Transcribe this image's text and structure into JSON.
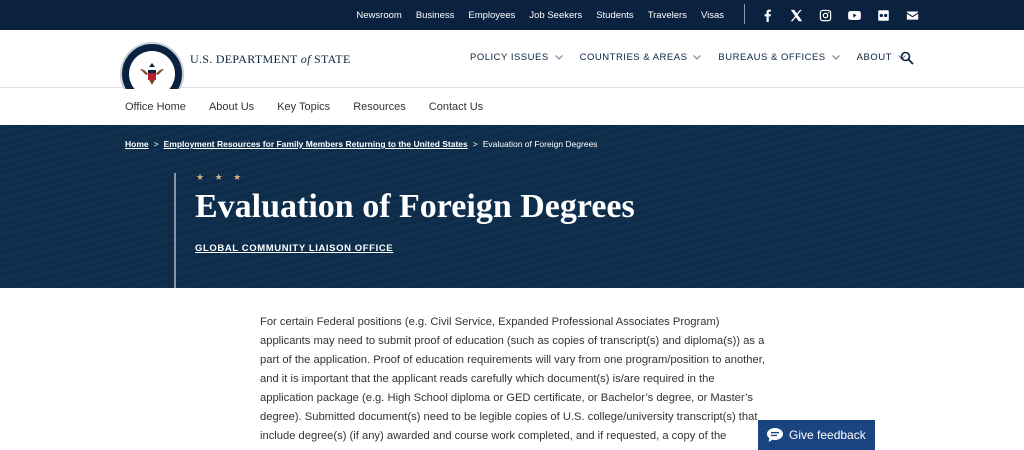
{
  "topbar": {
    "links": [
      "Newsroom",
      "Business",
      "Employees",
      "Job Seekers",
      "Students",
      "Travelers",
      "Visas"
    ],
    "social_icons": [
      "facebook-icon",
      "x-icon",
      "instagram-icon",
      "youtube-icon",
      "flickr-icon",
      "email-icon"
    ]
  },
  "header": {
    "brand_prefix": "U.S. DEPARTMENT",
    "brand_of": "of",
    "brand_suffix": "STATE",
    "nav": [
      "POLICY ISSUES",
      "COUNTRIES & AREAS",
      "BUREAUS & OFFICES",
      "ABOUT"
    ]
  },
  "subnav": {
    "links": [
      "Office Home",
      "About Us",
      "Key Topics",
      "Resources",
      "Contact Us"
    ]
  },
  "hero": {
    "breadcrumb_home": "Home",
    "breadcrumb_sep": ">",
    "breadcrumb_parent": "Employment Resources for Family Members Returning to the United States",
    "breadcrumb_current": "Evaluation of Foreign Degrees",
    "stars": "★ ★ ★",
    "title": "Evaluation of Foreign Degrees",
    "subtitle": "GLOBAL COMMUNITY LIAISON OFFICE"
  },
  "main": {
    "paragraph": "For certain Federal positions (e.g. Civil Service, Expanded Professional Associates Program) applicants may need to submit proof of education (such as copies of transcript(s) and diploma(s)) as a part of the application. Proof of education requirements will vary from one program/position to another, and it is important that the applicant reads carefully which document(s) is/are required in the application package (e.g. High School diploma or GED certificate, or Bachelor’s degree, or Master’s degree). Submitted document(s) need to be legible copies of U.S. college/university transcript(s) that include degree(s) (if any) awarded and course work completed, and if requested, a copy of the diploma."
  },
  "feedback": {
    "label": "Give feedback"
  },
  "colors": {
    "navy": "#0a2240",
    "hero": "#0d2d4c",
    "gold": "#d7b27d",
    "feedback": "#1a4480"
  }
}
